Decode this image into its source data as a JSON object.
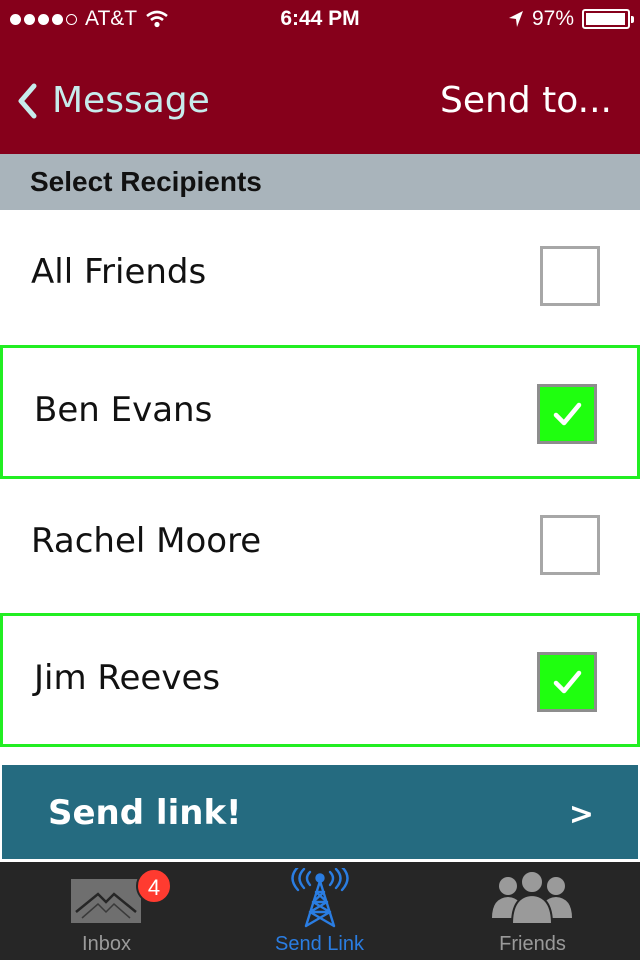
{
  "status_bar": {
    "carrier": "AT&T",
    "time": "6:44 PM",
    "battery": "97%",
    "battery_level": 0.97
  },
  "nav": {
    "back_label": "Message",
    "title_right": "Send to..."
  },
  "section_header": "Select Recipients",
  "recipients": [
    {
      "name": "All Friends",
      "checked": false
    },
    {
      "name": "Ben Evans",
      "checked": true
    },
    {
      "name": "Rachel Moore",
      "checked": false
    },
    {
      "name": "Jim Reeves",
      "checked": true
    }
  ],
  "send_button": {
    "label": "Send link!",
    "arrow": ">"
  },
  "tabs": [
    {
      "label": "Inbox",
      "icon": "envelope-icon",
      "badge": "4",
      "active": false
    },
    {
      "label": "Send Link",
      "icon": "antenna-icon",
      "active": true
    },
    {
      "label": "Friends",
      "icon": "people-icon",
      "active": false
    }
  ],
  "colors": {
    "nav_background": "#86001b",
    "section_background": "#a9b4bb",
    "selected_outline": "#22ee22",
    "checkbox_on": "#1fff0f",
    "send_background": "#256b80",
    "tab_active": "#2a7de2"
  }
}
